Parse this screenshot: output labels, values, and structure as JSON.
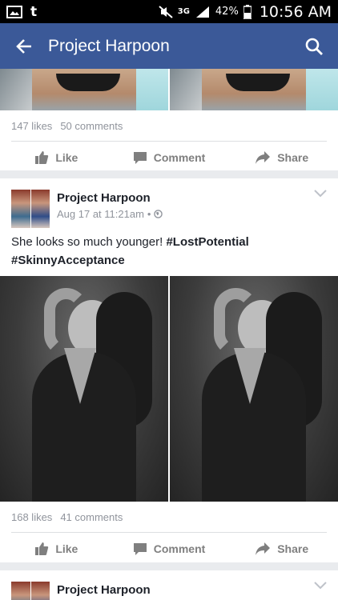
{
  "status_bar": {
    "carrier_icon": "t",
    "network": "3G",
    "battery": "42%",
    "time": "10:56 AM"
  },
  "app_bar": {
    "title": "Project Harpoon"
  },
  "posts": [
    {
      "likes": "147 likes",
      "comments": "50 comments",
      "actions": {
        "like": "Like",
        "comment": "Comment",
        "share": "Share"
      }
    },
    {
      "page_name": "Project Harpoon",
      "timestamp": "Aug 17 at 11:21am",
      "separator": "•",
      "text_line1_plain": "She looks so much younger! ",
      "hashtag1": "#LostPotential",
      "hashtag2": "#SkinnyAcceptance",
      "likes": "168 likes",
      "comments": "41 comments",
      "actions": {
        "like": "Like",
        "comment": "Comment",
        "share": "Share"
      }
    },
    {
      "page_name": "Project Harpoon"
    }
  ],
  "colors": {
    "brand": "#3b5998",
    "action_gray": "#7f7f7f",
    "meta_gray": "#90949c"
  }
}
